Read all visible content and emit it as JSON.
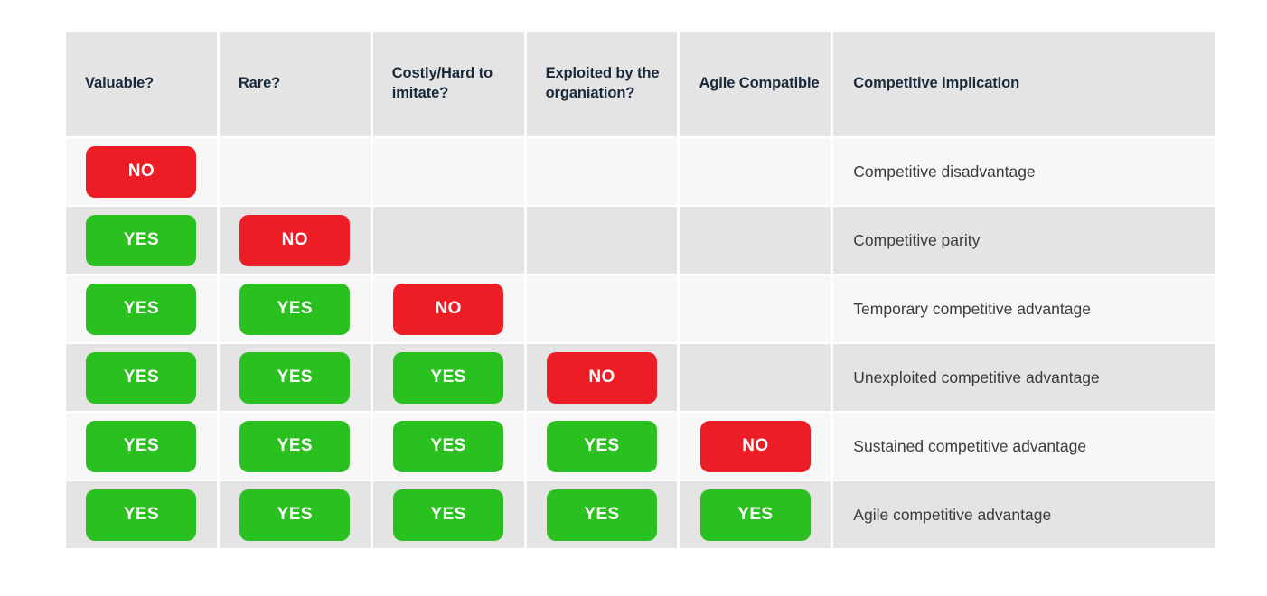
{
  "table": {
    "headers": [
      {
        "label": "Valuable?"
      },
      {
        "label": "Rare?"
      },
      {
        "label": "Costly/Hard to imitate?"
      },
      {
        "label": "Exploited by the organiation?"
      },
      {
        "label": "Agile Compatible"
      },
      {
        "label": "Competitive implication"
      }
    ],
    "rows": [
      {
        "cells": [
          "NO",
          "",
          "",
          "",
          ""
        ],
        "implication": "Competitive disadvantage"
      },
      {
        "cells": [
          "YES",
          "NO",
          "",
          "",
          ""
        ],
        "implication": "Competitive parity"
      },
      {
        "cells": [
          "YES",
          "YES",
          "NO",
          "",
          ""
        ],
        "implication": "Temporary competitive advantage"
      },
      {
        "cells": [
          "YES",
          "YES",
          "YES",
          "NO",
          ""
        ],
        "implication": "Unexploited competitive advantage"
      },
      {
        "cells": [
          "YES",
          "YES",
          "YES",
          "YES",
          "NO"
        ],
        "implication": "Sustained competitive advantage"
      },
      {
        "cells": [
          "YES",
          "YES",
          "YES",
          "YES",
          "YES"
        ],
        "implication": "Agile competitive advantage"
      }
    ]
  },
  "colors": {
    "yes": "#2ac01f",
    "no": "#ec1d25",
    "header_bg": "#e4e4e4",
    "header_text": "#17293a",
    "row_odd_bg": "#f7f7f7",
    "row_even_bg": "#e4e4e4",
    "implication_text": "#3c3c3c",
    "page_bg": "#ffffff"
  }
}
